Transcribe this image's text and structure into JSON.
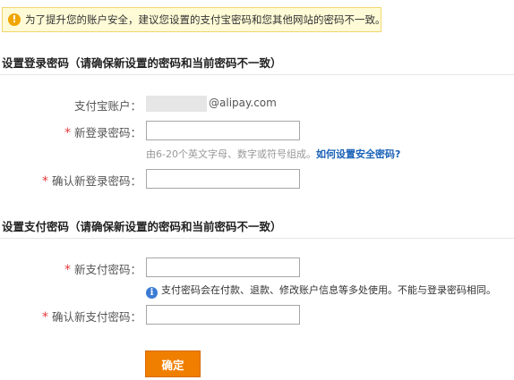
{
  "notice": {
    "icon": "exclamation-icon",
    "text": "为了提升您的账户安全，建议您设置的支付宝密码和您其他网站的密码不一致。"
  },
  "login_section": {
    "title": "设置登录密码（请确保新设置的密码和当前密码不一致）",
    "account_label": "支付宝账户：",
    "account_domain": "@alipay.com",
    "new_label": "新登录密码：",
    "confirm_label": "确认新登录密码：",
    "hint": "由6-20个英文字母、数字或符号组成。",
    "hint_link": "如何设置安全密码?"
  },
  "pay_section": {
    "title": "设置支付密码（请确保新设置的密码和当前密码不一致）",
    "new_label": "新支付密码：",
    "confirm_label": "确认新支付密码：",
    "info_icon": "info-icon",
    "info_text": "支付密码会在付款、退款、修改账户信息等多处使用。不能与登录密码相同。"
  },
  "required_mark": "*",
  "submit_label": "确定"
}
